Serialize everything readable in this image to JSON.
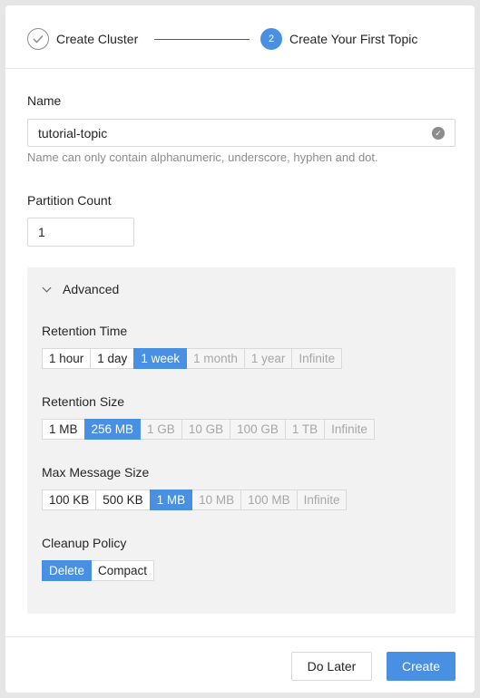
{
  "steps": [
    {
      "label": "Create Cluster",
      "state": "done",
      "icon": "check-icon"
    },
    {
      "label": "Create Your First Topic",
      "state": "active",
      "number": "2"
    }
  ],
  "name": {
    "label": "Name",
    "value": "tutorial-topic",
    "hint": "Name can only contain alphanumeric, underscore, hyphen and dot."
  },
  "partition": {
    "label": "Partition Count",
    "value": "1"
  },
  "advanced": {
    "label": "Advanced",
    "retention_time": {
      "label": "Retention Time",
      "options": [
        "1 hour",
        "1 day",
        "1 week",
        "1 month",
        "1 year",
        "Infinite"
      ],
      "selected": "1 week"
    },
    "retention_size": {
      "label": "Retention Size",
      "options": [
        "1 MB",
        "256 MB",
        "1 GB",
        "10 GB",
        "100 GB",
        "1 TB",
        "Infinite"
      ],
      "selected": "256 MB"
    },
    "max_message_size": {
      "label": "Max Message Size",
      "options": [
        "100 KB",
        "500 KB",
        "1 MB",
        "10 MB",
        "100 MB",
        "Infinite"
      ],
      "selected": "1 MB"
    },
    "cleanup_policy": {
      "label": "Cleanup Policy",
      "options": [
        "Delete",
        "Compact"
      ],
      "selected": "Delete"
    }
  },
  "footer": {
    "do_later_label": "Do Later",
    "create_label": "Create"
  },
  "colors": {
    "accent": "#4a90e2",
    "panel": "#f2f2f2"
  }
}
